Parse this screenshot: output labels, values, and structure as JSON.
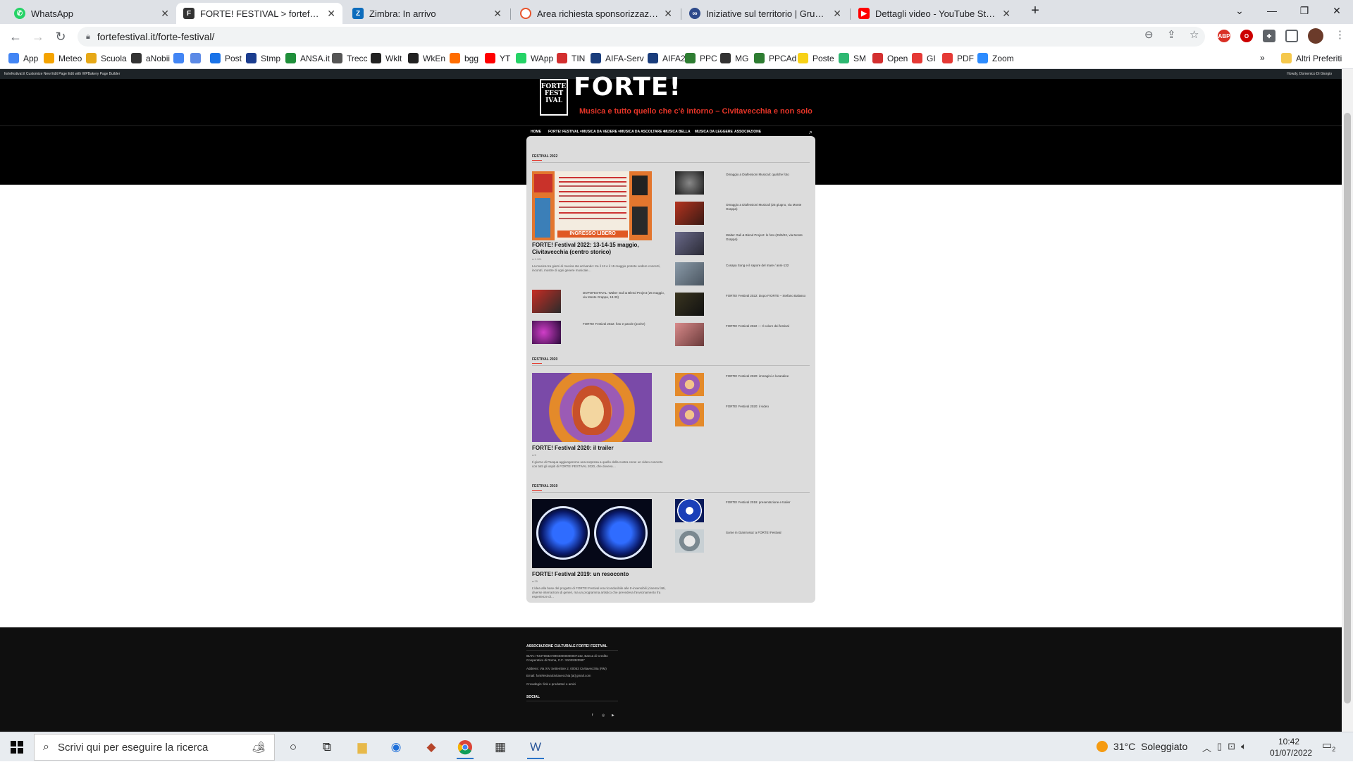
{
  "tabs": [
    {
      "title": "WhatsApp",
      "icon": "whatsapp-icon",
      "color": "#25d366"
    },
    {
      "title": "FORTE! FESTIVAL > fortefestival.it",
      "icon": "fortefestival-icon",
      "color": "#333333",
      "active": true
    },
    {
      "title": "Zimbra: In arrivo",
      "icon": "zimbra-icon",
      "color": "#0c6cbc"
    },
    {
      "title": "Area richiesta sponsorizzazioni | E",
      "icon": "sponsor-icon",
      "color": "#e8542c"
    },
    {
      "title": "Iniziative sul territorio | Gruppo D",
      "icon": "gruppo-icon",
      "color": "#2e4a8b"
    },
    {
      "title": "Dettagli video - YouTube Studio",
      "icon": "youtube-icon",
      "color": "#ff0000"
    }
  ],
  "browser": {
    "url": "fortefestival.it/forte-festival/",
    "new_tab": "+",
    "close_glyph": "✕"
  },
  "bookmarks": [
    {
      "label": "App",
      "color": "#4285f4"
    },
    {
      "label": "Meteo",
      "color": "#f4a300"
    },
    {
      "label": "Scuola",
      "color": "#e6a817"
    },
    {
      "label": "aNobii",
      "color": "#333333"
    },
    {
      "label": "",
      "color": "#4285f4"
    },
    {
      "label": "",
      "color": "#5c8ae6"
    },
    {
      "label": "Post",
      "color": "#1a73e8"
    },
    {
      "label": "Stmp",
      "color": "#1b3d8f"
    },
    {
      "label": "ANSA.it",
      "color": "#1f8f3a"
    },
    {
      "label": "Trecc",
      "color": "#555555"
    },
    {
      "label": "Wklt",
      "color": "#222222"
    },
    {
      "label": "WkEn",
      "color": "#222222"
    },
    {
      "label": "bgg",
      "color": "#ff6d00"
    },
    {
      "label": "YT",
      "color": "#ff0000"
    },
    {
      "label": "WApp",
      "color": "#25d366"
    },
    {
      "label": "TIN",
      "color": "#d32f2f"
    },
    {
      "label": "AIFA-Serv",
      "color": "#1a3d7c"
    },
    {
      "label": "AIFA2",
      "color": "#1a3d7c"
    },
    {
      "label": "PPC",
      "color": "#2e7d32"
    },
    {
      "label": "MG",
      "color": "#333333"
    },
    {
      "label": "PPCAd",
      "color": "#2e7d32"
    },
    {
      "label": "Poste",
      "color": "#f7d117"
    },
    {
      "label": "SM",
      "color": "#2eb872"
    },
    {
      "label": "Open",
      "color": "#d32f2f"
    },
    {
      "label": "GI",
      "color": "#e53935"
    },
    {
      "label": "PDF",
      "color": "#e53935"
    },
    {
      "label": "Zoom",
      "color": "#2d8cff"
    }
  ],
  "bookmarks_more": "»",
  "bookmarks_other": "Altri Preferiti",
  "site": {
    "adminbar_left": "fortefestival.it   Customize   New   Edit Page   Edit with WPBakery Page Builder",
    "adminbar_right": "Howdy, Domenico Di Giorgio",
    "logo_badge": "FORTE! FEST IVAL",
    "logo_text": "FORTE! FESTIVAL",
    "tagline": "Musica e tutto quello che c'è intorno – Civitavecchia e non solo",
    "menu": [
      "HOME",
      "FORTE! FESTIVAL ▾",
      "MUSICA DA VEDERE ▾",
      "MUSICA DA ASCOLTARE ▾",
      "MUSICA BELLA",
      "MUSICA DA LEGGERE",
      "ASSOCIAZIONE"
    ]
  },
  "sections": [
    {
      "heading": "FESTIVAL 2022",
      "featured": {
        "title": "FORTE! Festival 2022: 13-14-15 maggio, Civitavecchia (centro storico)",
        "meta": "● 1.101",
        "excerpt": "La musica tra giorni di musica sta arrivando: tra il 13 e il 15 maggio potrete vedere concerti, incontri, mostre di ogni genere musicale…",
        "poster_band": "INGRESSO LIBERO"
      },
      "small_left": [
        "DOPOFESTIVAL: Walter Gali & Blend Project (25 maggio, via Monte Grappa, 18.30)",
        "FORTE! Festival 2022: foto e parole (poche)"
      ],
      "small_right": [
        "Omaggio a Diafessioni Musicali: qualche foto",
        "Omaggio a Diafessioni Musicali (25 giugno, via Monte Grappa)",
        "Walter Gali & Blend Project: le foto (25/5/22, via Monte Grappa)",
        "Cosapa Song e il sapore del mare / anni-132",
        "FORTE! Festival 2022: Dopo FIORTE – Stefano Balasso",
        "FORTE! Festival 2022 — Il colore dei festival"
      ]
    },
    {
      "heading": "FESTIVAL 2020",
      "featured": {
        "title": "FORTE! Festival 2020: il trailer",
        "meta": "● 5",
        "excerpt": "Il giorno di Pasqua aggiungeremo una sorpresa a quello della nostra cena: un video concerto con tutti gli ospiti di FORTE! FESTIVAL 2020, che doveva…"
      },
      "small_right": [
        "FORTE! Festival 2020: immagini e locandine",
        "FORTE! Festival 2020: il video"
      ]
    },
    {
      "heading": "FESTIVAL 2019",
      "featured": {
        "title": "FORTE! Festival 2019: un resoconto",
        "meta": "● 25",
        "excerpt": "L'idea alla base del progetto di FORTE! Festival era riconducibile alle tr-insensibili (cinema fatti, diverse intersezioni di generi, ma un programma artistico che prevedeva l'avvicinamento fra esperienze di…"
      },
      "small_right": [
        "FORTE! Festival 2019: presentazione e trailer",
        "Some in Giamrossa' a FORTE! Festival"
      ]
    }
  ],
  "footer": {
    "heading": "ASSOCIAZIONE CULTURALE FORTE! FESTIVAL",
    "iban": "IBAN: IT23T0832739040000000007142, Banca di Credito Cooperativo di Roma, C.F.: 91029320587",
    "address": "Address: Via XIV Settembre 2, 00053 Civitavecchia (RM)",
    "email": "Email: fortefestivalcivitavecchia [at] gmail.com",
    "crowdegin": "Crowdegin: link e produttori e amici",
    "social_heading": "SOCIAL",
    "social": [
      "f",
      "◎",
      "▶"
    ]
  },
  "taskbar": {
    "search_placeholder": "Scrivi qui per eseguire la ricerca",
    "weather_temp": "31°C",
    "weather_text": "Soleggiato",
    "time": "10:42",
    "date": "01/07/2022",
    "notifications": "2"
  }
}
